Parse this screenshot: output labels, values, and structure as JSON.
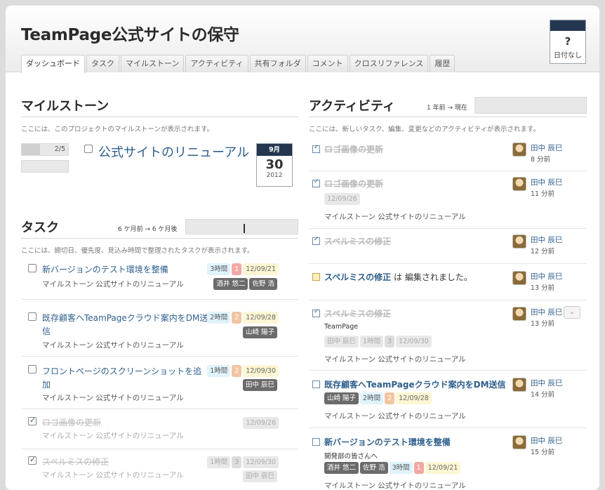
{
  "page_title": "TeamPage公式サイトの保守",
  "tabs": [
    "ダッシュボード",
    "タスク",
    "マイルストーン",
    "アクティビティ",
    "共有フォルダ",
    "コメント",
    "クロスリファレンス",
    "履歴"
  ],
  "date_badge": {
    "symbol": "?",
    "label": "日付なし"
  },
  "milestones": {
    "heading": "マイルストーン",
    "description": "ここには、このプロジェクトのマイルストーンが表示されます。",
    "progress_text": "2/5",
    "progress": 0.4,
    "item": {
      "title": "公式サイトのリニューアル",
      "month": "9月",
      "day": "30",
      "year": "2012"
    }
  },
  "tasks": {
    "heading": "タスク",
    "range_label": "6 ケ月前 → 6 ケ月後",
    "description": "ここには、締切日、優先度、見込み時間で整理されたタスクが表示されます。",
    "items": [
      {
        "title": "新バージョンのテスト環境を整備",
        "milestone": "マイルストーン 公式サイトのリニューアル",
        "hours": "3時間",
        "priority": "1",
        "date": "12/09/21",
        "users": [
          "酒井 悠二",
          "佐野 浩"
        ],
        "done": false
      },
      {
        "title": "既存顧客へTeamPageクラウド案内をDM送",
        "title2": "信",
        "milestone": "マイルストーン 公式サイトのリニューアル",
        "hours": "2時間",
        "priority": "2",
        "date": "12/09/28",
        "users": [
          "山崎 陽子"
        ],
        "done": false
      },
      {
        "title": "フロントページのスクリーンショットを追",
        "title2": "加",
        "milestone": "マイルストーン 公式サイトのリニューアル",
        "hours": "1時間",
        "priority": "2",
        "date": "12/09/30",
        "users": [
          "田中 辰巳"
        ],
        "done": false
      },
      {
        "title": "ロゴ画像の更新",
        "milestone": "マイルストーン 公式サイトのリニューアル",
        "date": "12/09/26",
        "done": true
      },
      {
        "title": "スペルミスの修正",
        "milestone": "マイルストーン 公式サイトのリニューアル",
        "hours": "1時間",
        "priority": "3",
        "date": "12/09/30",
        "users": [
          "田中 辰巳"
        ],
        "done": true
      }
    ]
  },
  "activity": {
    "heading": "アクティビティ",
    "range_label": "1 年前 → 現在",
    "description": "ここには、新しいタスク、編集、変更などのアクティビティが表示されます。",
    "items": [
      {
        "title": "ロゴ画像の更新",
        "user": "田中 辰巳",
        "ago": "8 分前"
      },
      {
        "title": "ロゴ画像の更新",
        "date": "12/09/26",
        "milestone": "マイルストーン 公式サイトのリニューアル",
        "user": "田中 辰巳",
        "ago": "11 分前"
      },
      {
        "title": "スペルミスの修正",
        "user": "田中 辰巳",
        "ago": "12 分前"
      },
      {
        "title": "スペルミスの修正",
        "suffix": "は 編集されました。",
        "user": "田中 辰巳",
        "ago": "13 分前"
      },
      {
        "title": "スペルミスの修正",
        "sub": "TeamPage",
        "user_chip": "田中 辰巳",
        "hours": "1時間",
        "priority": "3",
        "date": "12/09/30",
        "milestone": "マイルストーン 公式サイトのリニューアル",
        "user": "田中 辰巳",
        "ago": "13 分前"
      },
      {
        "title": "既存顧客へTeamPageクラウド案内をDM送信",
        "user_chip": "山崎 陽子",
        "hours": "2時間",
        "priority": "2",
        "date": "12/09/28",
        "milestone": "マイルストーン 公式サイトのリニューアル",
        "user": "田中 辰巳",
        "ago": "14 分前"
      },
      {
        "title": "新バージョンのテスト環境を整備",
        "sub": "開発部の皆さんへ",
        "user_chips": [
          "酒井 悠二",
          "佐野 浩"
        ],
        "hours": "3時間",
        "priority": "1",
        "date": "12/09/21",
        "milestone": "マイルストーン 公式サイトのリニューアル",
        "user": "田中 辰巳",
        "ago": "15 分前"
      }
    ]
  }
}
